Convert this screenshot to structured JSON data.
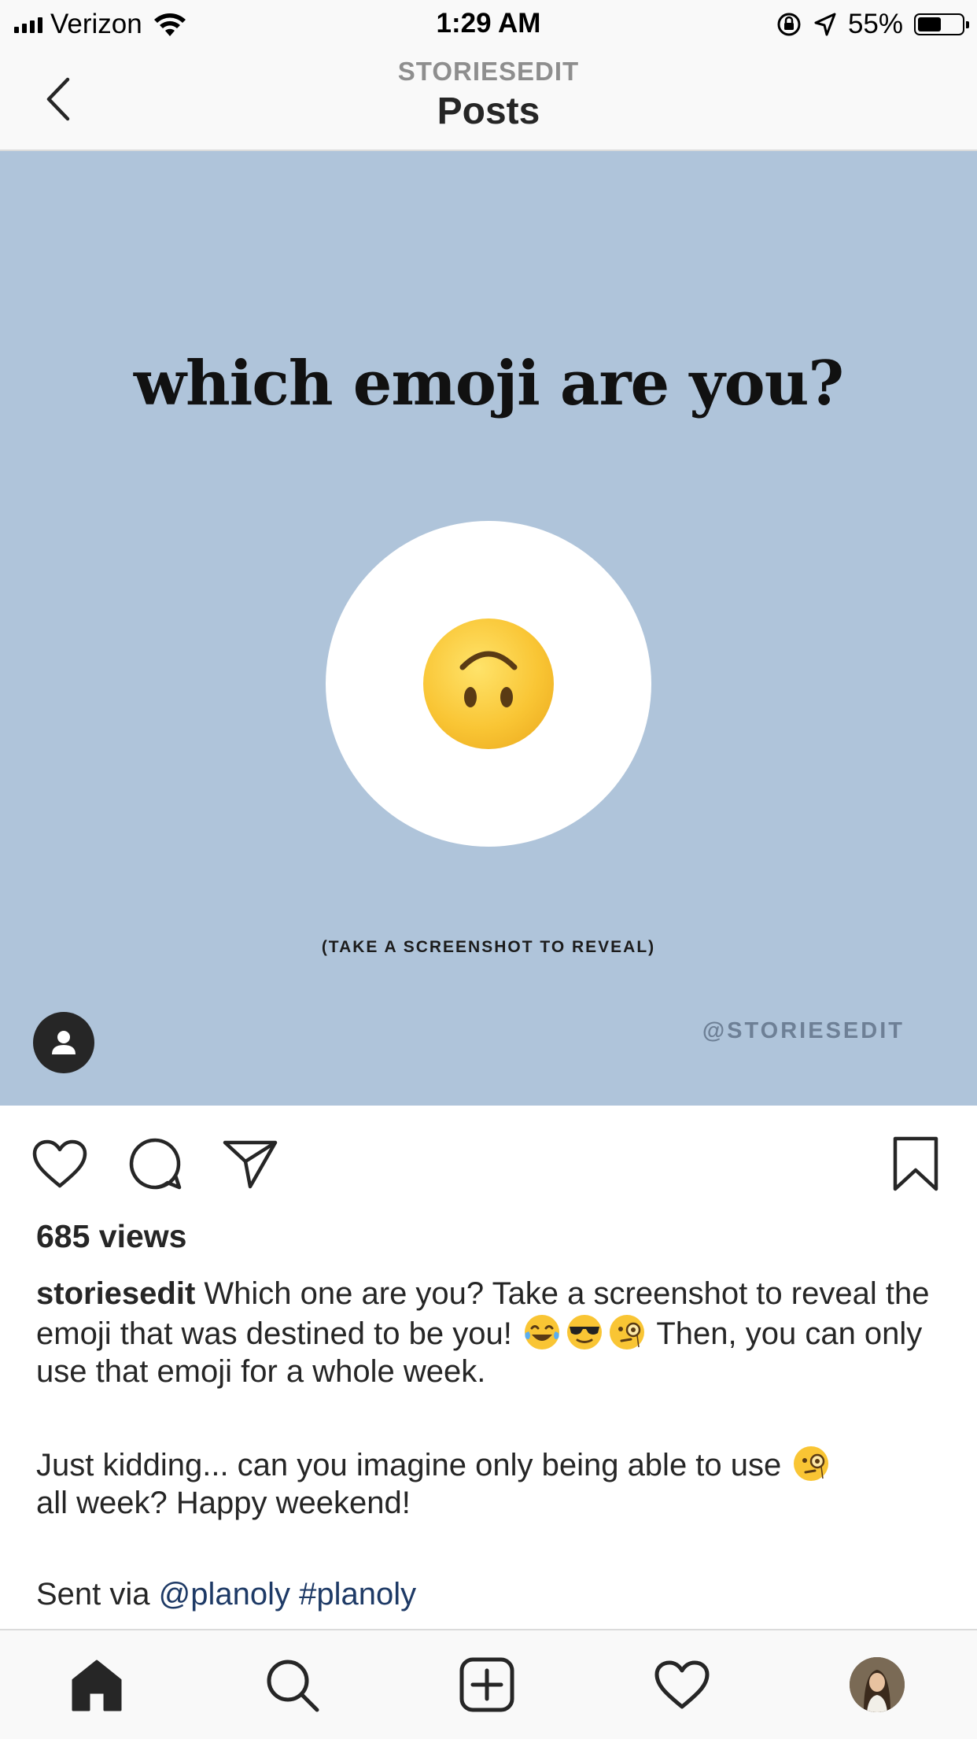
{
  "status": {
    "carrier": "Verizon",
    "time": "1:29 AM",
    "battery_pct": "55%",
    "battery_level": 0.55
  },
  "nav": {
    "subtitle": "STORIESEDIT",
    "title": "Posts",
    "back_icon": "chevron-left-icon"
  },
  "post": {
    "headline": "which emoji are you?",
    "reveal_text": "(TAKE A SCREENSHOT TO REVEAL)",
    "watermark": "@STORIESEDIT",
    "emoji": "upside-down-face"
  },
  "actions": {
    "like_icon": "heart-icon",
    "comment_icon": "comment-icon",
    "share_icon": "send-icon",
    "save_icon": "bookmark-icon"
  },
  "views": "685 views",
  "caption": {
    "username": "storiesedit",
    "text1": " Which one are you? Take a screenshot to reveal the emoji that was destined to be you! ",
    "text1_end": " Then, you can only use that emoji for a whole week.",
    "text2": "Just kidding... can you imagine only being able to use ",
    "text2_end": " all week? Happy weekend!",
    "sent_via": "Sent via ",
    "mention": "@planoly",
    "hashtag": "#planoly",
    "emojis_line1": [
      "tears-of-joy",
      "sunglasses",
      "monocle"
    ],
    "emoji_line2": "monocle"
  },
  "tabbar": {
    "items": [
      "home-icon",
      "search-icon",
      "add-post-icon",
      "activity-icon",
      "profile-avatar"
    ]
  }
}
